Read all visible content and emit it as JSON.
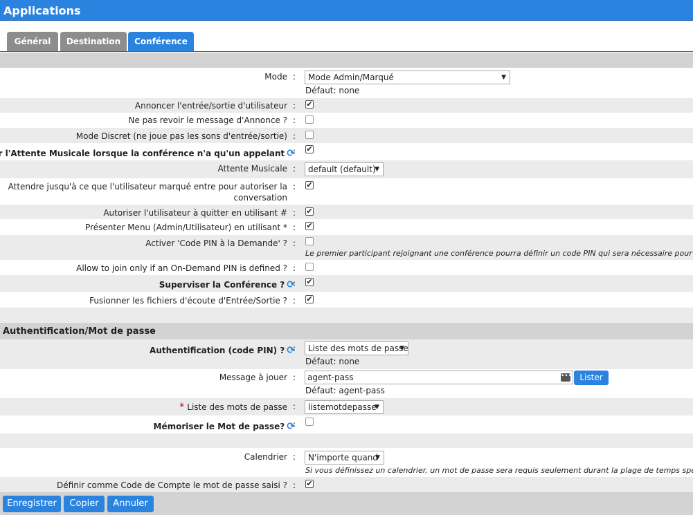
{
  "window": {
    "title": "Applications"
  },
  "tabs": [
    {
      "label": "Général"
    },
    {
      "label": "Destination"
    },
    {
      "label": "Conférence"
    }
  ],
  "conference": {
    "mode": {
      "label": "Mode",
      "value": "Mode Admin/Marqué",
      "default": "Défaut: none"
    },
    "announce_join_leave": {
      "label": "Annoncer l'entrée/sortie d'utilisateur",
      "checked": true
    },
    "no_review_announce": {
      "label": "Ne pas revoir le message d'Annonce ?",
      "checked": false
    },
    "discreet_mode": {
      "label": "Mode Discret (ne joue pas les sons d'entrée/sortie)",
      "checked": false
    },
    "music_on_hold_single": {
      "label": "Activer l'Attente Musicale lorsque la conférence n'a qu'un appelant",
      "checked": true
    },
    "music_on_hold": {
      "label": "Attente Musicale",
      "value": "default (default)"
    },
    "wait_marked_user_1": {
      "label": "Attendre jusqu'à ce que l'utilisateur marqué entre pour autoriser la"
    },
    "wait_marked_user_2": {
      "label": "conversation",
      "checked": true
    },
    "allow_quit_hash": {
      "label": "Autoriser l'utilisateur à quitter en utilisant #",
      "checked": true
    },
    "present_menu": {
      "label": "Présenter Menu (Admin/Utilisateur) en utilisant *",
      "checked": true
    },
    "pin_on_demand": {
      "label": "Activer 'Code PIN à la Demande' ?",
      "checked": false,
      "hint": "Le premier participant rejoignant une conférence pourra définir un code PIN qui sera nécessaire pour tout no"
    },
    "join_only_pin": {
      "label": "Allow to join only if an On-Demand PIN is defined ?",
      "checked": false
    },
    "supervise": {
      "label": "Superviser la Conférence ?",
      "checked": true
    },
    "merge_recordings": {
      "label": "Fusionner les fichiers d'écoute d'Entrée/Sortie ?",
      "checked": true
    }
  },
  "auth": {
    "section_title": "Authentification/Mot de passe",
    "auth_pin": {
      "label": "Authentification (code PIN) ?",
      "value": "Liste des mots de passe",
      "default": "Défaut: none"
    },
    "message": {
      "label": "Message à jouer",
      "value": "agent-pass",
      "default": "Défaut: agent-pass",
      "button": "Lister"
    },
    "password_list": {
      "required_mark": "*",
      "label": "Liste des mots de passe",
      "value": "listemotdepasse"
    },
    "remember_password": {
      "label": "Mémoriser le Mot de passe?",
      "checked": false
    },
    "calendar": {
      "label": "Calendrier",
      "value": "N'importe quand",
      "hint": "Si vous définissez un calendrier, un mot de passe sera requis seulement durant la plage de temps spécifiée."
    },
    "account_code": {
      "label": "Définir comme Code de Compte le mot de passe saisi ?",
      "checked": true
    }
  },
  "colon": ":",
  "check_glyph": "✔",
  "arrow_glyph": "▼",
  "dots_glyph": "•••",
  "sync_glyph": "⟳",
  "footer": {
    "save": "Enregistrer",
    "copy": "Copier",
    "cancel": "Annuler"
  },
  "colors": {
    "accent": "#2b83e0",
    "tab_inactive": "#8d8d8d",
    "row_alt": "#ebebeb",
    "section": "#d3d3d3",
    "required": "#c00000"
  }
}
